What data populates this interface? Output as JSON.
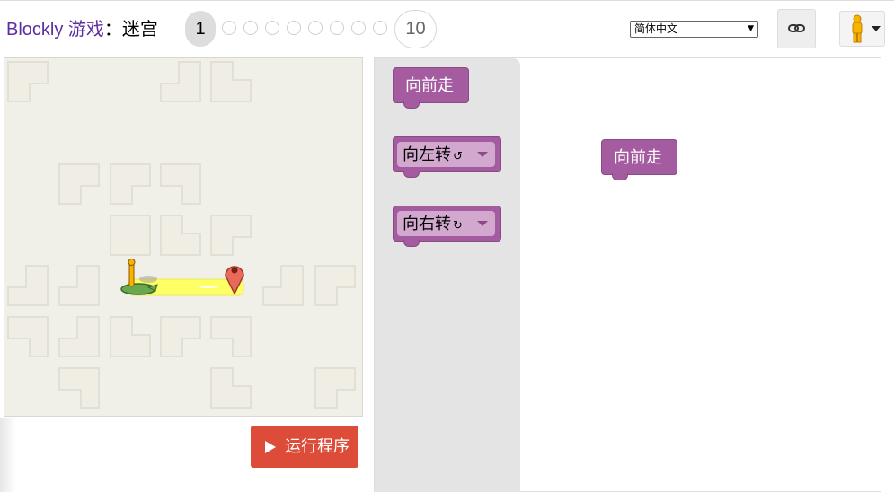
{
  "header": {
    "app_name": "Blockly 游戏",
    "separator": "：",
    "page_name": "迷宫",
    "levels": {
      "current": "1",
      "last": "10"
    },
    "language": {
      "selected": "简体中文"
    },
    "icons": {
      "link": "link-icon",
      "avatar": "pegman-icon"
    }
  },
  "run_button": {
    "label": "运行程序",
    "icon": "play-icon"
  },
  "toolbox": {
    "blocks": [
      {
        "label": "向前走"
      },
      {
        "label": "向左转",
        "symbol": "↺"
      },
      {
        "label": "向右转",
        "symbol": "↻"
      }
    ]
  },
  "workspace": {
    "blocks": [
      {
        "label": "向前走"
      }
    ]
  },
  "colors": {
    "brand_text": "#5b2fa0",
    "block": "#a55b9f",
    "run_button": "#dd4b39",
    "path": "#ffff66",
    "maze_bg": "#f0efe8",
    "flyout_bg": "#e4e4e4"
  }
}
